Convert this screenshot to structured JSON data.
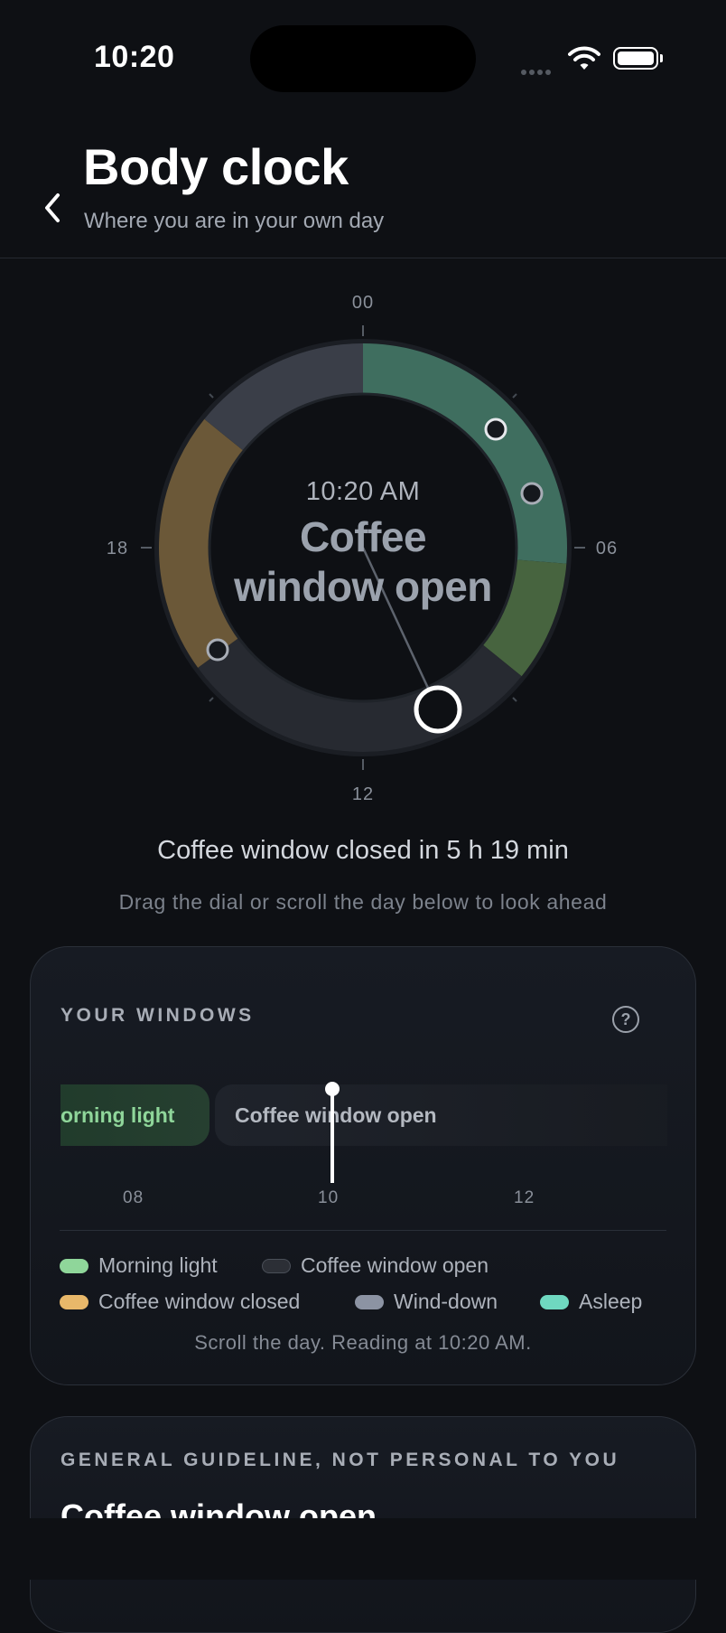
{
  "status_bar": {
    "time": "10:20"
  },
  "header": {
    "title": "Body clock",
    "subtitle": "Where you are in your own day"
  },
  "dial": {
    "hour_labels": {
      "top": "00",
      "right": "06",
      "bottom": "12",
      "left": "18"
    },
    "current_time": "10:20 AM",
    "status_line1": "Coffee",
    "status_line2": "window open",
    "colors": {
      "asleep": "#3f6e5f",
      "morning_light": "#47643f",
      "coffee_open": "#272a31",
      "coffee_closed": "#6b5838",
      "wind_down": "#3a3e48"
    }
  },
  "countdown": "Coffee window closed in 5 h 19 min",
  "hint": "Drag the dial or scroll the day below to look ahead",
  "windows_card": {
    "title": "YOUR WINDOWS",
    "help_icon": "?",
    "segments": {
      "morning": "orning light",
      "coffee": "Coffee window open"
    },
    "ticks": [
      "08",
      "10",
      "12"
    ],
    "legend": [
      {
        "label": "Morning light",
        "color": "#8fd69a"
      },
      {
        "label": "Coffee window open",
        "color": "#2c2f36"
      },
      {
        "label": "Coffee window closed",
        "color": "#e8b86a"
      },
      {
        "label": "Wind-down",
        "color": "#8c93a3"
      },
      {
        "label": "Asleep",
        "color": "#6fd8c0"
      }
    ],
    "footnote": "Scroll the day. Reading at 10:20 AM."
  },
  "guideline_card": {
    "label": "GENERAL GUIDELINE, NOT PERSONAL TO YOU",
    "heading": "Coffee window open"
  }
}
